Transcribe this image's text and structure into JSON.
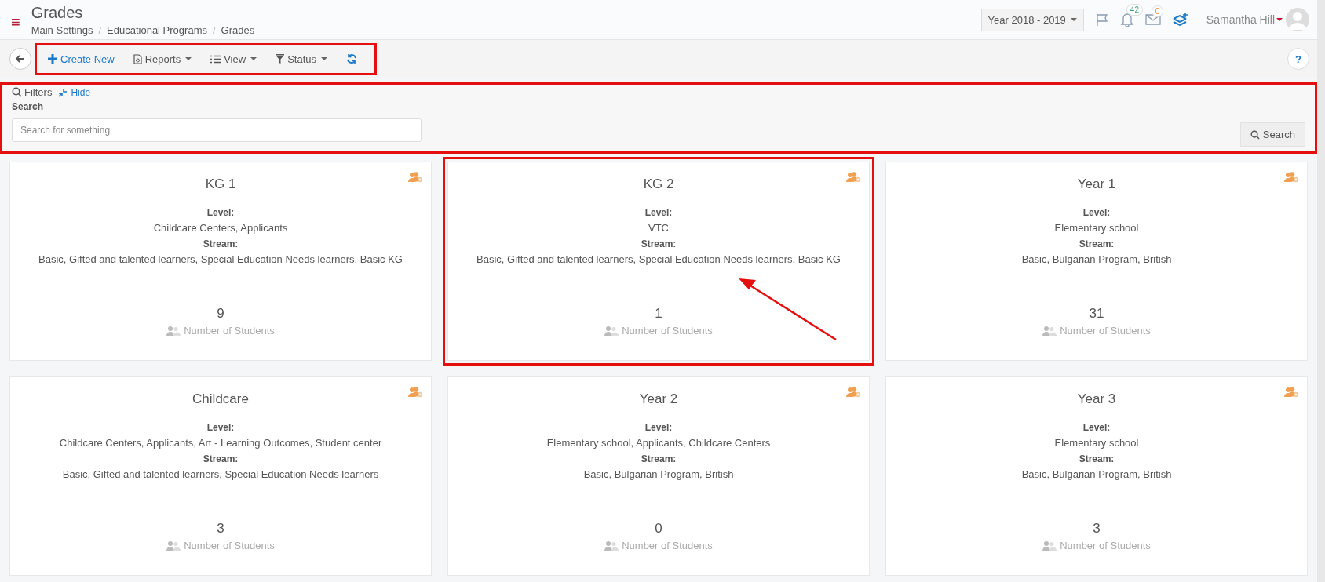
{
  "header": {
    "menu_icon": "≡",
    "title": "Grades",
    "breadcrumbs": [
      "Main Settings",
      "Educational Programs",
      "Grades"
    ],
    "breadcrumb_separator": "/",
    "year_selector": "Year 2018 - 2019",
    "notifications_count": "42",
    "messages_count": "0",
    "user_name": "Samantha Hill"
  },
  "toolbar": {
    "highlighted": true,
    "buttons": [
      {
        "kind": "create",
        "label": "Create New",
        "dropdown": false
      },
      {
        "kind": "reports",
        "label": "Reports",
        "dropdown": true
      },
      {
        "kind": "view",
        "label": "View",
        "dropdown": true
      },
      {
        "kind": "status",
        "label": "Status",
        "dropdown": true
      },
      {
        "kind": "refresh"
      }
    ],
    "help": "?"
  },
  "filters": {
    "highlighted": true,
    "title": "Filters",
    "hide_link": "Hide",
    "search_label": "Search",
    "search_placeholder": "Search for something",
    "search_button": "Search"
  },
  "cards": [
    {
      "title": "KG 1",
      "level_label": "Level:",
      "level": "Childcare Centers, Applicants",
      "stream_label": "Stream:",
      "stream": "Basic, Gifted and talented learners, Special Education Needs learners, Basic KG",
      "count": "9",
      "count_label": "Number of Students",
      "highlighted": false,
      "arrow": false
    },
    {
      "title": "KG 2",
      "level_label": "Level:",
      "level": "VTC",
      "stream_label": "Stream:",
      "stream": "Basic, Gifted and talented learners, Special Education Needs learners, Basic KG",
      "count": "1",
      "count_label": "Number of Students",
      "highlighted": true,
      "arrow": true
    },
    {
      "title": "Year 1",
      "level_label": "Level:",
      "level": "Elementary school",
      "stream_label": "Stream:",
      "stream": "Basic, Bulgarian Program, British",
      "count": "31",
      "count_label": "Number of Students",
      "highlighted": false,
      "arrow": false
    },
    {
      "title": "Childcare",
      "level_label": "Level:",
      "level": "Childcare Centers, Applicants, Art - Learning Outcomes, Student center",
      "stream_label": "Stream:",
      "stream": "Basic, Gifted and talented learners, Special Education Needs learners",
      "count": "3",
      "count_label": "Number of Students",
      "highlighted": false,
      "arrow": false
    },
    {
      "title": "Year 2",
      "level_label": "Level:",
      "level": "Elementary school, Applicants, Childcare Centers",
      "stream_label": "Stream:",
      "stream": "Basic, Bulgarian Program, British",
      "count": "0",
      "count_label": "Number of Students",
      "highlighted": false,
      "arrow": false
    },
    {
      "title": "Year 3",
      "level_label": "Level:",
      "level": "Elementary school",
      "stream_label": "Stream:",
      "stream": "Basic, Bulgarian Program, British",
      "count": "3",
      "count_label": "Number of Students",
      "highlighted": false,
      "arrow": false
    }
  ]
}
